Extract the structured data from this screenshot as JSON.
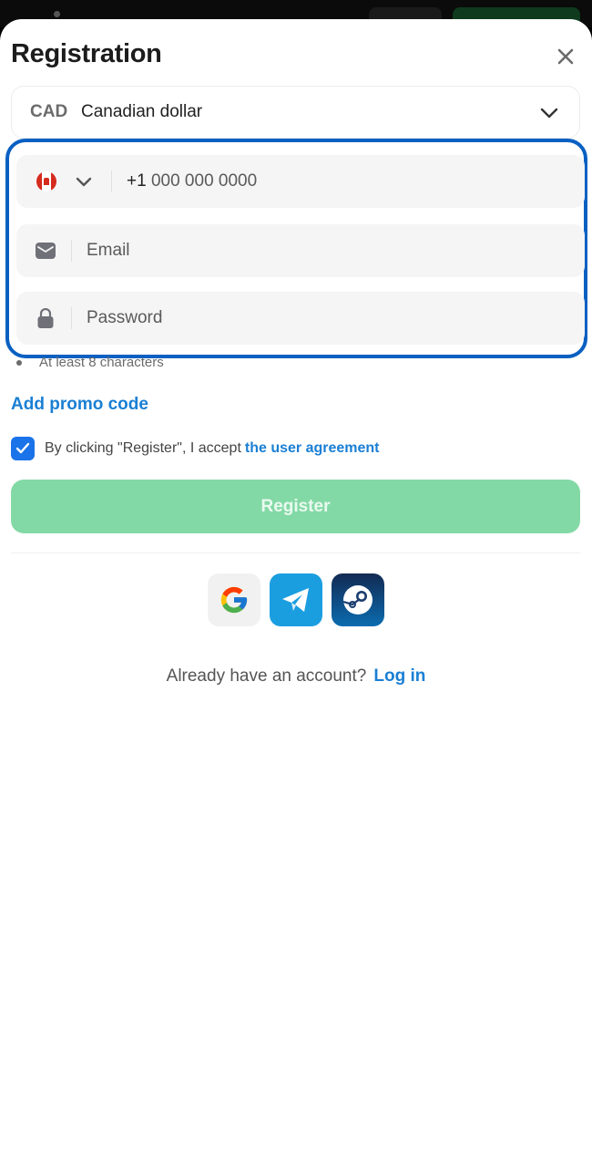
{
  "header": {
    "title": "Registration"
  },
  "currency": {
    "code": "CAD",
    "name": "Canadian dollar"
  },
  "phone": {
    "prefix": "+1",
    "placeholder": "000 000 0000",
    "country_flag": "canada-flag-icon"
  },
  "email": {
    "placeholder": "Email"
  },
  "password": {
    "placeholder": "Password",
    "hint": "At least 8 characters"
  },
  "promo": {
    "label": "Add promo code"
  },
  "agreement": {
    "text": "By clicking \"Register\", I accept",
    "link": "the user agreement",
    "checked": true
  },
  "register": {
    "label": "Register"
  },
  "socials": [
    {
      "name": "google",
      "icon": "google-icon"
    },
    {
      "name": "telegram",
      "icon": "telegram-icon"
    },
    {
      "name": "steam",
      "icon": "steam-icon"
    }
  ],
  "login": {
    "question": "Already have an account?",
    "link": "Log in"
  },
  "colors": {
    "accent": "#1a7fd4",
    "focus_border": "#0a60c2",
    "register_bg": "#83d9a5",
    "checkbox": "#1a73e8"
  }
}
